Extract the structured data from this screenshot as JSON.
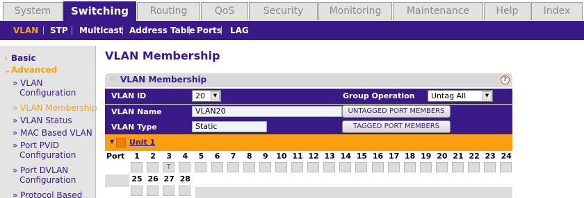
{
  "top_tabs": [
    {
      "label": "System",
      "active": false
    },
    {
      "label": "Switching",
      "active": true
    },
    {
      "label": "Routing",
      "active": false
    },
    {
      "label": "QoS",
      "active": false
    },
    {
      "label": "Security",
      "active": false
    },
    {
      "label": "Monitoring",
      "active": false
    },
    {
      "label": "Maintenance",
      "active": false
    },
    {
      "label": "Help",
      "active": false
    },
    {
      "label": "Index",
      "active": false
    }
  ],
  "sub_menu": [
    {
      "label": "VLAN",
      "active": true
    },
    {
      "label": "STP",
      "active": false
    },
    {
      "label": "Multicast",
      "active": false
    },
    {
      "label": "Address Table",
      "active": false
    },
    {
      "label": "Ports",
      "active": false
    },
    {
      "label": "LAG",
      "active": false
    }
  ],
  "sidebar": {
    "basic": "Basic",
    "advanced": "Advanced",
    "items": [
      {
        "line1": "VLAN",
        "line2": "Configuration"
      },
      {
        "line1": "VLAN Membership",
        "line2": ""
      },
      {
        "line1": "VLAN Status",
        "line2": ""
      },
      {
        "line1": "MAC Based VLAN",
        "line2": ""
      },
      {
        "line1": "Port PVID",
        "line2": "Configuration"
      },
      {
        "line1": "Port DVLAN",
        "line2": "Configuration"
      },
      {
        "line1": "Protocol Based",
        "line2": ""
      }
    ],
    "chevron": "»"
  },
  "main": {
    "page_title": "VLAN Membership",
    "panel_title": "VLAN Membership",
    "help_glyph": "?",
    "vlan_id_label": "VLAN ID",
    "vlan_id_value": "20",
    "group_operation_label": "Group Operation",
    "group_operation_value": "Untag All",
    "vlan_name_label": "VLAN Name",
    "vlan_name_value": "VLAN20",
    "vlan_type_label": "VLAN Type",
    "vlan_type_value": "Static",
    "untagged_button": "UNTAGGED PORT MEMBERS",
    "tagged_button": "TAGGED PORT MEMBERS",
    "unit_label": "Unit 1",
    "port_label": "Port",
    "ports_row1": [
      "1",
      "2",
      "3",
      "4",
      "5",
      "6",
      "7",
      "8",
      "9",
      "10",
      "11",
      "12",
      "13",
      "14",
      "15",
      "16",
      "17",
      "18",
      "19",
      "20",
      "21",
      "22",
      "23",
      "24"
    ],
    "ports_row1_marks": [
      "",
      "",
      "T",
      "",
      "",
      "",
      "",
      "",
      "",
      "",
      "",
      "",
      "",
      "",
      "",
      "",
      "",
      "",
      "",
      "",
      "",
      "",
      "",
      ""
    ],
    "ports_row2": [
      "25",
      "26",
      "27",
      "28"
    ],
    "ports_row2_marks": [
      "",
      "",
      "",
      ""
    ]
  }
}
